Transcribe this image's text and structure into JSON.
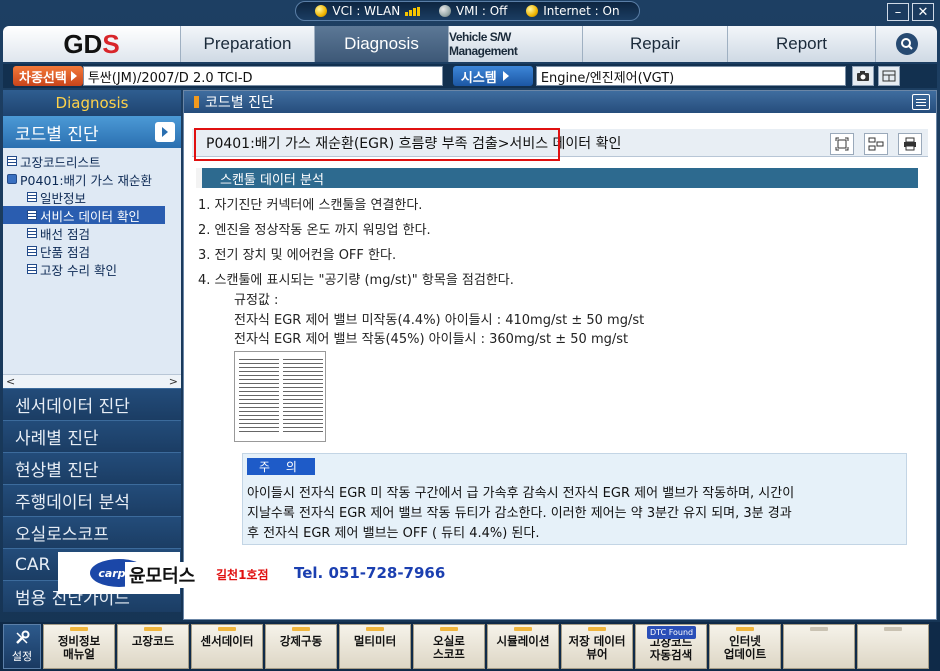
{
  "statusbar": {
    "vci": "VCI : WLAN",
    "vmi": "VMI : Off",
    "internet": "Internet : On"
  },
  "window_buttons": {
    "minimize": "–",
    "close": "✕"
  },
  "logo": {
    "text": "GD",
    "accent": "S"
  },
  "nav": {
    "tabs": [
      {
        "label": "Preparation"
      },
      {
        "label": "Diagnosis"
      },
      {
        "label": "Vehicle S/W Management"
      },
      {
        "label": "Repair"
      },
      {
        "label": "Report"
      }
    ],
    "active": "Diagnosis"
  },
  "vehicle_row": {
    "select_label": "차종선택",
    "vehicle_value": "투싼(JM)/2007/D 2.0 TCI-D",
    "system_label": "시스템",
    "system_value": "Engine/엔진제어(VGT)"
  },
  "sidebar": {
    "header": "Diagnosis",
    "current_category": "코드별 진단",
    "tree": [
      {
        "label": "고장코드리스트",
        "level": 0
      },
      {
        "label": "P0401:배기 가스 재순환",
        "level": 0
      },
      {
        "label": "일반정보",
        "level": 1
      },
      {
        "label": "서비스 데이터 확인",
        "level": 1,
        "selected": true
      },
      {
        "label": "배선 점검",
        "level": 1
      },
      {
        "label": "단품 점검",
        "level": 1
      },
      {
        "label": "고장 수리 확인",
        "level": 1
      }
    ],
    "scroll_left": "<",
    "scroll_right": ">",
    "categories": [
      {
        "label": "센서데이터 진단"
      },
      {
        "label": "사례별 진단"
      },
      {
        "label": "현상별 진단"
      },
      {
        "label": "주행데이터 분석"
      },
      {
        "label": "오실로스코프"
      },
      {
        "label": "CAR"
      },
      {
        "label": "범용 진단가이드"
      }
    ]
  },
  "main": {
    "header": "코드별 진단",
    "title": "P0401:배기 가스 재순환(EGR) 흐름량 부족 검출>서비스 데이터 확인",
    "section": "스캔툴 데이터 분석",
    "steps": [
      "1. 자기진단 커넥터에 스캔툴을 연결한다.",
      "2. 엔진을 정상작동 온도 까지 워밍업 한다.",
      "3. 전기 장치 및 에어컨을 OFF 한다.",
      "4. 스캔툴에 표시되는 \"공기량 (mg/st)\" 항목을 점검한다."
    ],
    "spec_label": "규정값 :",
    "specs": [
      "전자식 EGR 제어 밸브 미작동(4.4%) 아이들시 : 410mg/st ± 50 mg/st",
      "전자식 EGR 제어 밸브 작동(45%) 아이들시 : 360mg/st ± 50 mg/st"
    ],
    "note_label": "주 의",
    "note_lines": [
      "아이들시 전자식 EGR 미 작동 구간에서 급 가속후 감속시 전자식 EGR 제어 밸브가 작동하며, 시간이",
      "지날수록 전자식 EGR 제어 밸브 작동 듀티가 감소한다. 이러한 제어는 약 3분간 유지 되며, 3분 경과",
      "후 전자식 EGR 제어 밸브는 OFF ( 듀티 4.4%) 된다."
    ]
  },
  "banner": {
    "logo": "carpos",
    "company": "윤모터스",
    "branch": "길천1호점",
    "tel": "Tel. 051-728-7966"
  },
  "bottom": {
    "settings": "설정",
    "buttons": [
      {
        "label": "정비정보\n매뉴얼",
        "led": true
      },
      {
        "label": "고장코드",
        "led": true
      },
      {
        "label": "센서데이터",
        "led": true
      },
      {
        "label": "강제구동",
        "led": true
      },
      {
        "label": "멀티미터",
        "led": true
      },
      {
        "label": "오실로\n스코프",
        "led": true
      },
      {
        "label": "시뮬레이션",
        "led": true
      },
      {
        "label": "저장 데이터\n뷰어",
        "led": true
      },
      {
        "label": "고장코드\n자동검색",
        "led": true,
        "badge": "DTC Found"
      },
      {
        "label": "인터넷\n업데이트",
        "led": true
      },
      {
        "label": "",
        "led": false
      },
      {
        "label": "",
        "led": false
      }
    ]
  },
  "colors": {
    "accent_red": "#e01010",
    "tel_blue": "#1b3fb0",
    "section_bar": "#2d6a8f"
  }
}
